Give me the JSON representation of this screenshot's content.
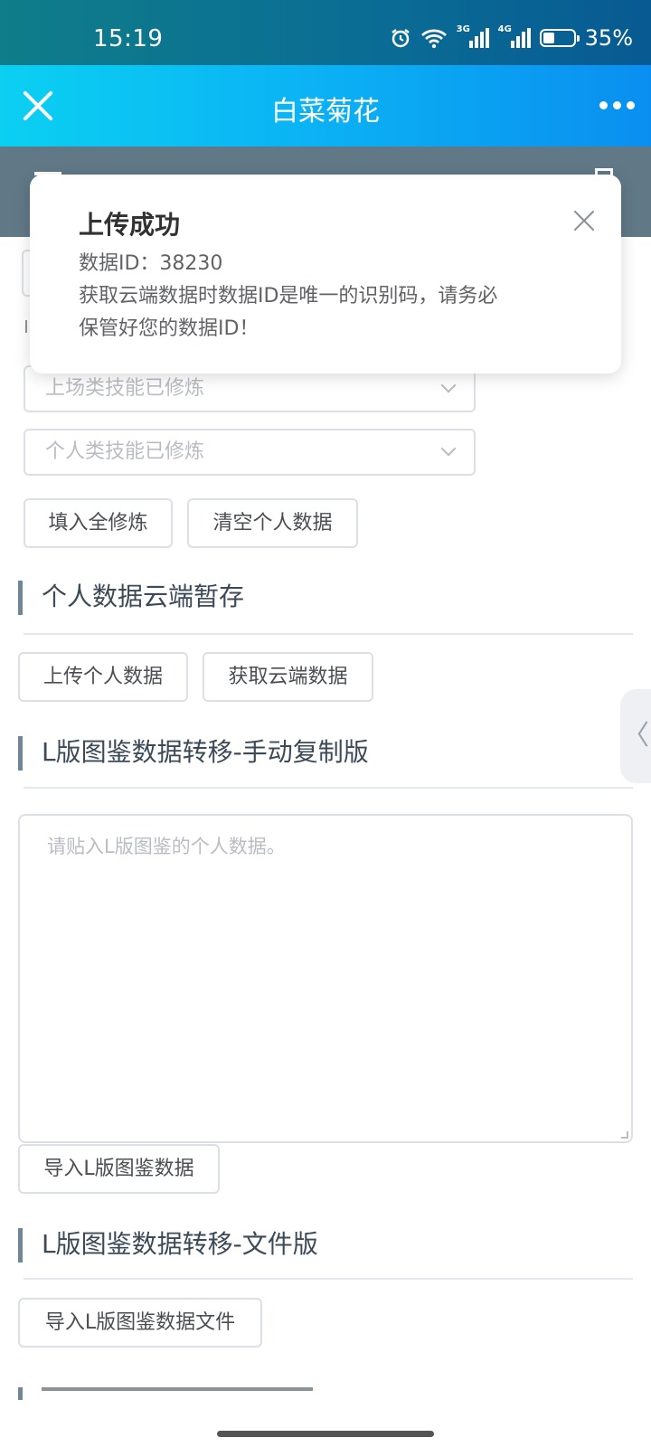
{
  "status_bar": {
    "time": "15:19",
    "battery_percent": "35%",
    "battery_level": 0.35,
    "network_1": "3G",
    "network_2": "4G",
    "icons": [
      "alarm-icon",
      "wifi-icon",
      "signal-3g-icon",
      "signal-4g-icon",
      "battery-icon"
    ]
  },
  "title_bar": {
    "title": "白菜菊花",
    "close_icon": "close-icon",
    "more_icon": "more-icon"
  },
  "form": {
    "select_1_placeholder": "上场类技能已修炼",
    "select_2_placeholder": "个人类技能已修炼",
    "fill_all_button": "填入全修炼",
    "clear_button": "清空个人数据"
  },
  "cloud_section": {
    "title": "个人数据云端暂存",
    "upload_button": "上传个人数据",
    "fetch_button": "获取云端数据"
  },
  "manual_section": {
    "title": "L版图鉴数据转移-手动复制版",
    "textarea_placeholder": "请贴入L版图鉴的个人数据。",
    "import_button": "导入L版图鉴数据"
  },
  "file_section": {
    "title": "L版图鉴数据转移-文件版",
    "import_file_button": "导入L版图鉴数据文件"
  },
  "toast": {
    "title": "上传成功",
    "line_1": "数据ID：38230",
    "line_2": "获取云端数据时数据ID是唯一的识别码，请务必",
    "line_3": "保管好您的数据ID！"
  },
  "side_tab": {
    "glyph": "〈"
  }
}
